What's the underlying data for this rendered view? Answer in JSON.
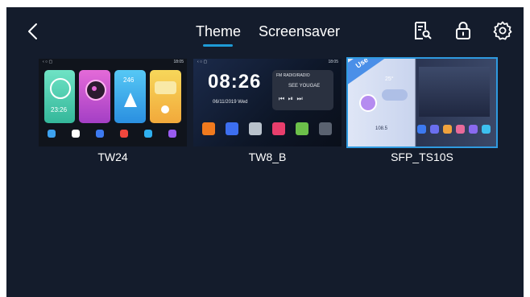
{
  "header": {
    "tabs": [
      {
        "label": "Theme",
        "active": true
      },
      {
        "label": "Screensaver",
        "active": false
      }
    ],
    "icons": [
      "back-icon",
      "document-search-icon",
      "lock-icon",
      "gear-icon"
    ],
    "accent": "#1e9bd6"
  },
  "themes": [
    {
      "name": "TW24",
      "selected": false,
      "thumb": {
        "status_time": "18:05",
        "clock": "23:26"
      }
    },
    {
      "name": "TW8_B",
      "selected": false,
      "thumb": {
        "status_time": "18:05",
        "clock": "08:26",
        "date": "06/11/2019 Wed",
        "radio": "FM RADIO/RADIO",
        "song": "SEE YOUGAE"
      }
    },
    {
      "name": "SFP_TS10S",
      "selected": true,
      "thumb": {
        "badge": "Use",
        "temp": "25°",
        "freq": "108.5"
      }
    }
  ],
  "colors": {
    "background": "#141c2c",
    "selected_border": "#2f9ae0"
  }
}
